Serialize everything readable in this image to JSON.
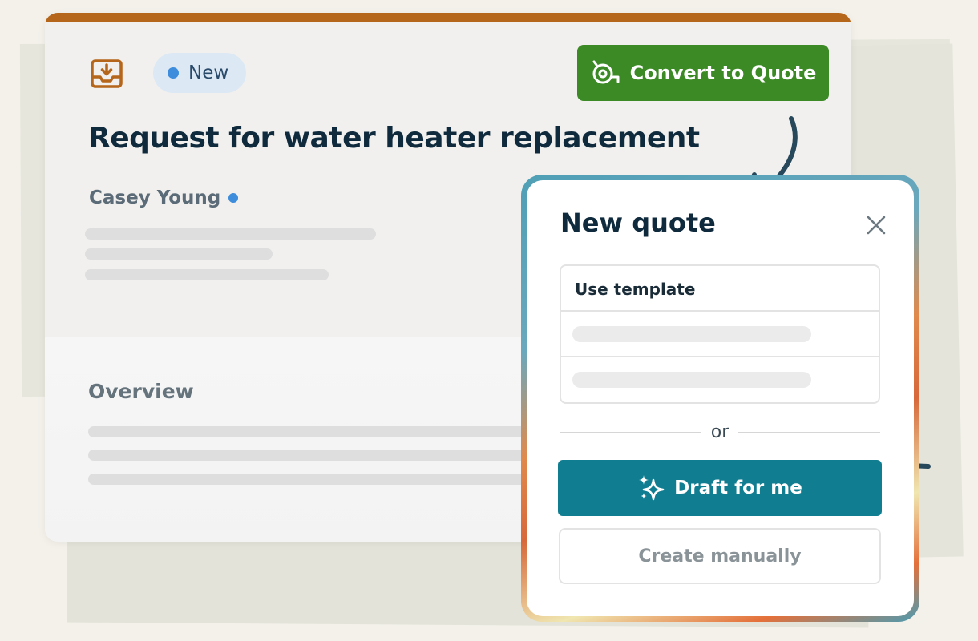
{
  "request": {
    "status_badge": "New",
    "convert_button": "Convert to Quote",
    "title": "Request for water heater replacement",
    "client_name": "Casey Young",
    "overview_heading": "Overview"
  },
  "modal": {
    "title": "New quote",
    "template_label": "Use template",
    "divider_text": "or",
    "draft_button": "Draft for me",
    "manual_button": "Create manually"
  },
  "colors": {
    "accent_bar": "#b5661a",
    "convert_button": "#3c8a25",
    "draft_button": "#107d91",
    "status_dot": "#3d8ddc",
    "heading": "#0f2a3c"
  },
  "icons": {
    "inbox": "inbox-download-icon",
    "convert": "tape-measure-icon",
    "close": "close-icon",
    "draft": "sparkles-icon"
  }
}
